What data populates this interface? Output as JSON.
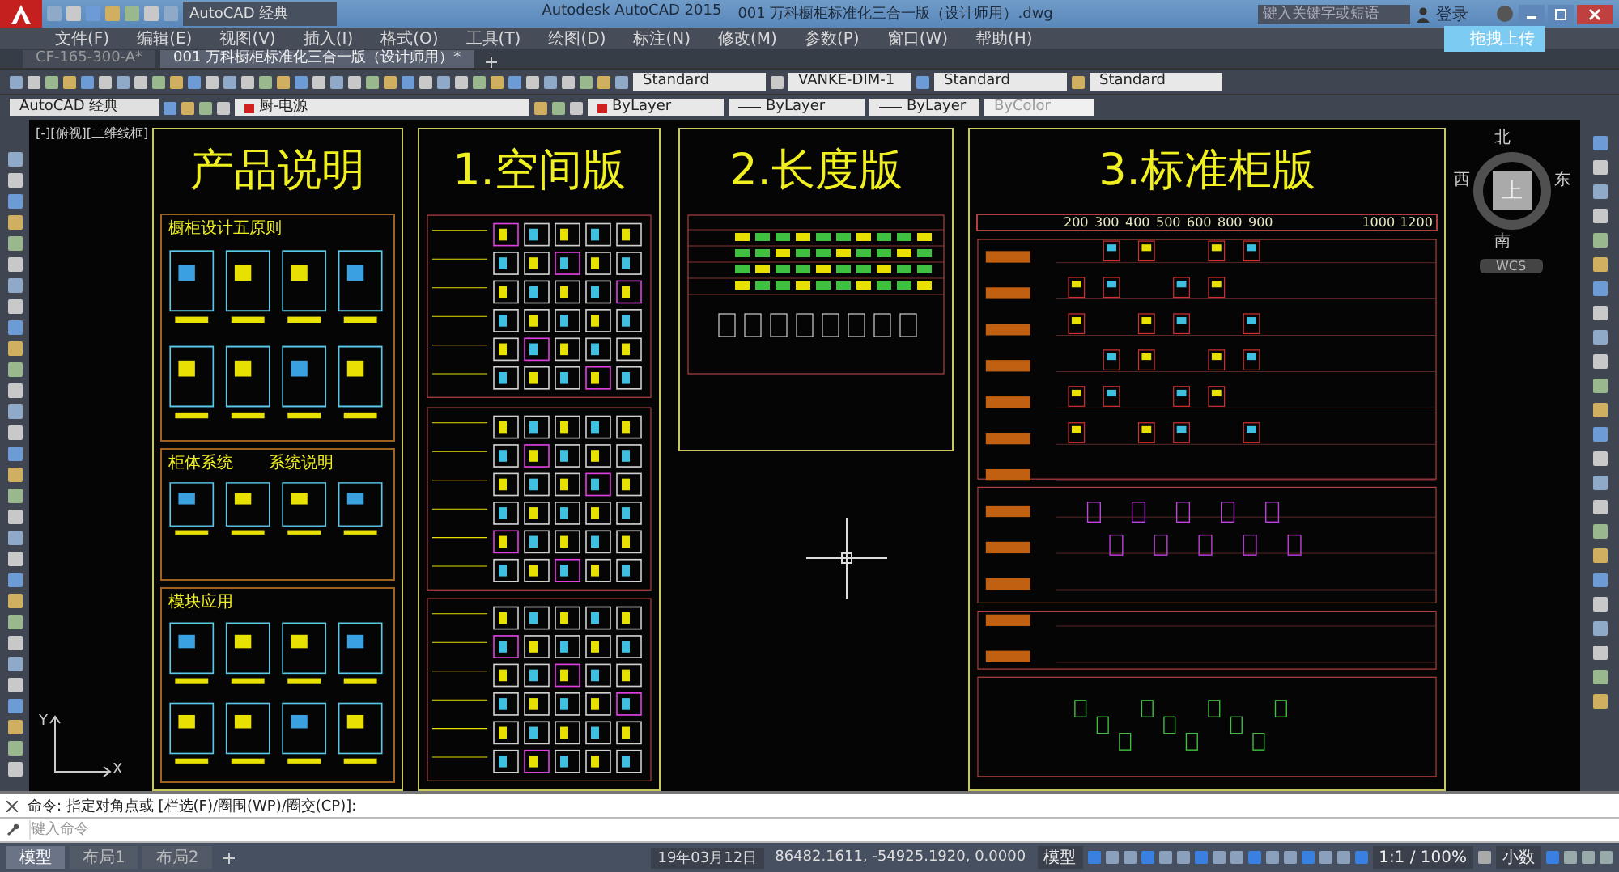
{
  "title_bar": {
    "workspace": "AutoCAD 经典",
    "app_title": "Autodesk AutoCAD 2015",
    "file_title": "001 万科橱柜标准化三合一版（设计师用）.dwg",
    "search": {
      "placeholder": "键入关键字或短语"
    },
    "sign_in": "登录",
    "tooltip": "拖拽上传"
  },
  "menu": [
    "文件(F)",
    "编辑(E)",
    "视图(V)",
    "插入(I)",
    "格式(O)",
    "工具(T)",
    "绘图(D)",
    "标注(N)",
    "修改(M)",
    "参数(P)",
    "窗口(W)",
    "帮助(H)"
  ],
  "doc_tabs": [
    {
      "label": "CF-165-300-A*",
      "selected": false
    },
    {
      "label": "001 万科橱柜标准化三合一版（设计师用）*",
      "selected": true
    }
  ],
  "toolbar_styles": [
    "Standard",
    "VANKE-DIM-1",
    "Standard",
    "Standard"
  ],
  "properties_bar": {
    "workspace": "AutoCAD 经典",
    "layer": "厨-电源",
    "color_control": "ByLayer",
    "linetype": "ByLayer",
    "lineweight": "ByLayer",
    "plot_style": "ByColor"
  },
  "viewport": {
    "label": "[-][俯视][二维线框]",
    "compass": {
      "north": "北",
      "south": "南",
      "east": "东",
      "west": "西",
      "top": "上",
      "ucs": "WCS"
    },
    "ucs_axes": {
      "x": "X",
      "y": "Y"
    }
  },
  "panels": [
    {
      "kind": "notes",
      "title": "产品说明",
      "sections": [
        {
          "headings": [
            "橱柜设计五原则"
          ]
        },
        {
          "headings": [
            "柜体系统",
            "系统说明"
          ]
        },
        {
          "headings": [
            "模块应用"
          ]
        }
      ]
    },
    {
      "kind": "space",
      "title": "1.空间版"
    },
    {
      "kind": "length",
      "title": "2.长度版"
    },
    {
      "kind": "standard",
      "title": "3.标准柜版",
      "columns": [
        "200",
        "300",
        "400",
        "500",
        "600",
        "800",
        "900",
        "1000",
        "1200"
      ]
    }
  ],
  "command": {
    "history": "命令: 指定对角点或 [栏选(F)/圈围(WP)/圈交(CP)]:",
    "placeholder": "键入命令"
  },
  "layout_tabs": [
    {
      "label": "模型",
      "selected": true
    },
    {
      "label": "布局1",
      "selected": false
    },
    {
      "label": "布局2",
      "selected": false
    }
  ],
  "status_bar": {
    "date": "19年03月12日",
    "coordinates": "86482.1611, -54925.1920, 0.0000",
    "space": "模型",
    "scale": "1:1 / 100%",
    "units": "小数"
  }
}
